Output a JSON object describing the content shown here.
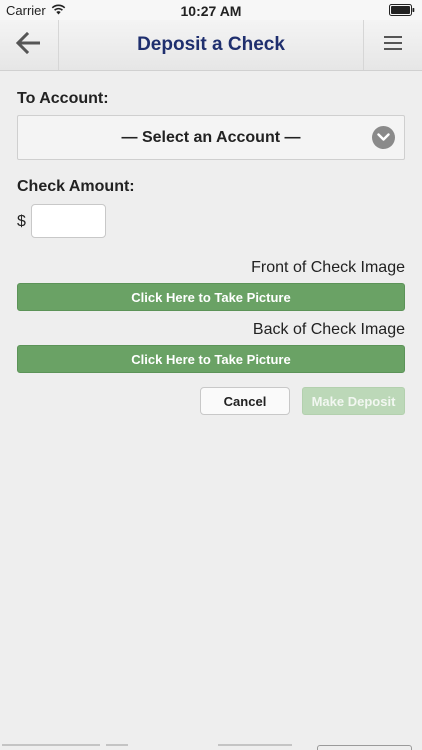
{
  "status_bar": {
    "carrier": "Carrier",
    "time": "10:27 AM"
  },
  "nav": {
    "title": "Deposit a Check",
    "back_icon": "back-arrow-icon",
    "menu_icon": "hamburger-menu-icon"
  },
  "form": {
    "to_account_label": "To Account:",
    "select_placeholder": "— Select an Account —",
    "check_amount_label": "Check Amount:",
    "currency_symbol": "$",
    "amount_value": "",
    "front_label": "Front of Check Image",
    "front_button": "Click Here to Take Picture",
    "back_label": "Back of Check Image",
    "back_button": "Click Here to Take Picture",
    "cancel_label": "Cancel",
    "deposit_label": "Make Deposit"
  },
  "colors": {
    "title": "#1f2f6e",
    "green_button": "#6aa265",
    "disabled_button": "#bcd8b8",
    "background": "#eeeeee"
  }
}
